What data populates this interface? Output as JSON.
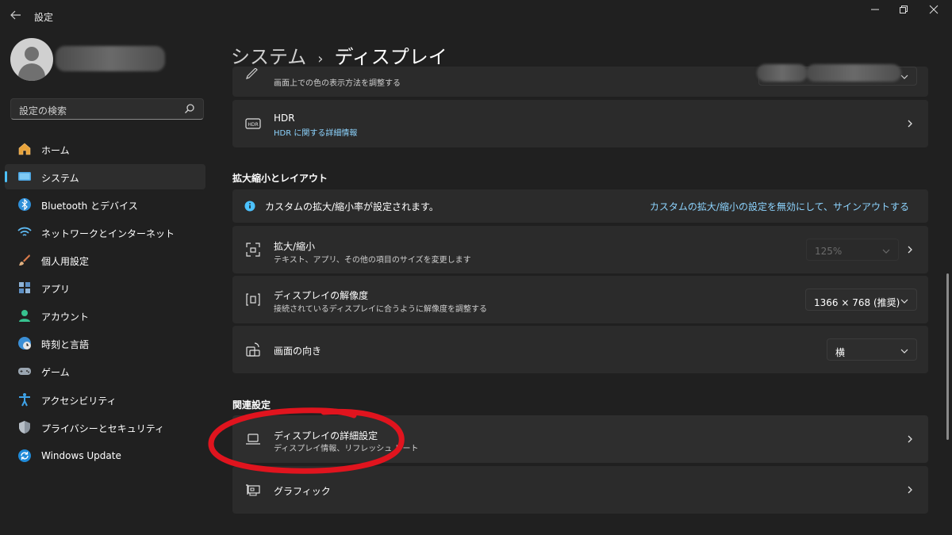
{
  "app": {
    "title": "設定",
    "back_icon": "arrow-left-icon"
  },
  "window_controls": [
    "minimize-icon",
    "restore-icon",
    "close-icon"
  ],
  "search": {
    "placeholder": "設定の検索"
  },
  "sidebar": {
    "items": [
      {
        "label": "ホーム",
        "icon": "home-icon",
        "selected": false
      },
      {
        "label": "システム",
        "icon": "system-icon",
        "selected": true
      },
      {
        "label": "Bluetooth とデバイス",
        "icon": "bluetooth-icon",
        "selected": false
      },
      {
        "label": "ネットワークとインターネット",
        "icon": "wifi-icon",
        "selected": false
      },
      {
        "label": "個人用設定",
        "icon": "brush-icon",
        "selected": false
      },
      {
        "label": "アプリ",
        "icon": "apps-icon",
        "selected": false
      },
      {
        "label": "アカウント",
        "icon": "account-icon",
        "selected": false
      },
      {
        "label": "時刻と言語",
        "icon": "globe-clock-icon",
        "selected": false
      },
      {
        "label": "ゲーム",
        "icon": "gamepad-icon",
        "selected": false
      },
      {
        "label": "アクセシビリティ",
        "icon": "accessibility-icon",
        "selected": false
      },
      {
        "label": "プライバシーとセキュリティ",
        "icon": "shield-icon",
        "selected": false
      },
      {
        "label": "Windows Update",
        "icon": "update-icon",
        "selected": false
      }
    ]
  },
  "breadcrumb": {
    "parent": "システム",
    "separator": "›",
    "current": "ディスプレイ"
  },
  "top_partial": {
    "subtitle": "画面上での色の表示方法を調整する"
  },
  "hdr": {
    "title": "HDR",
    "link": "HDR に関する詳細情報"
  },
  "scale_section": {
    "title": "拡大縮小とレイアウト",
    "info": {
      "text": "カスタムの拡大/縮小率が設定されます。",
      "link": "カスタムの拡大/縮小の設定を無効にして、サインアウトする"
    },
    "scale": {
      "title": "拡大/縮小",
      "subtitle": "テキスト、アプリ、その他の項目のサイズを変更します",
      "value": "125%",
      "disabled": true
    },
    "resolution": {
      "title": "ディスプレイの解像度",
      "subtitle": "接続されているディスプレイに合うように解像度を調整する",
      "value": "1366 × 768 (推奨)"
    },
    "orientation": {
      "title": "画面の向き",
      "value": "横"
    }
  },
  "related_section": {
    "title": "関連設定",
    "advanced": {
      "title": "ディスプレイの詳細設定",
      "subtitle": "ディスプレイ情報、リフレッシュ レート",
      "highlighted": true
    },
    "graphics": {
      "title": "グラフィック"
    }
  },
  "colors": {
    "accent": "#4cc2ff",
    "link": "#8dd4ff",
    "annotation": "#e0141e"
  }
}
